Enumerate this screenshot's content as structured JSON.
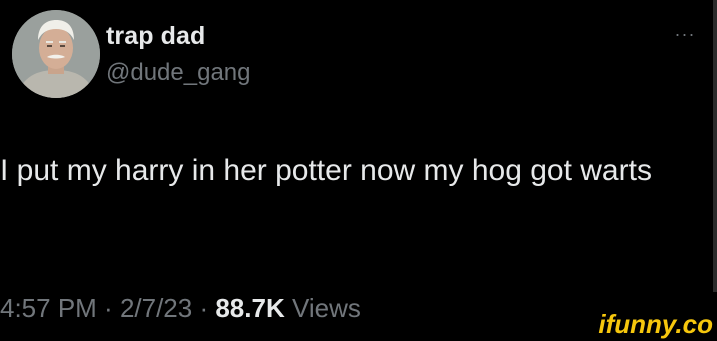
{
  "user": {
    "display_name": "trap dad",
    "handle": "@dude_gang"
  },
  "menu": {
    "more_label": "···"
  },
  "tweet": {
    "text": "I put my harry in her potter now my hog got warts"
  },
  "meta": {
    "time": "4:57 PM",
    "sep1": " · ",
    "date": "2/7/23",
    "sep2": " · ",
    "views_count": "88.7K",
    "views_label": " Views"
  },
  "watermark": {
    "text": "ifunny.co"
  },
  "colors": {
    "background": "#000000",
    "primary_text": "#e7e9ea",
    "secondary_text": "#71767b",
    "watermark": "#f6c70d"
  },
  "icons": {
    "avatar": "profile-photo",
    "more": "more-horizontal-icon"
  }
}
